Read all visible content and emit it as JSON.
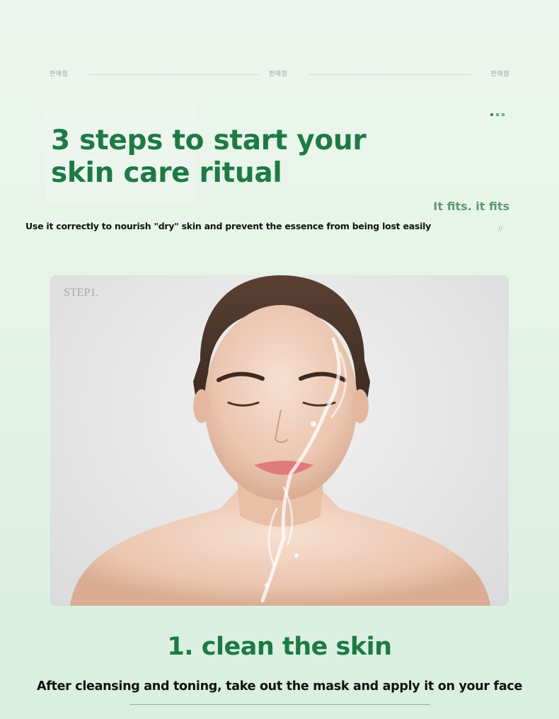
{
  "header": {
    "tags": [
      "판매점",
      "판매점",
      "판매점"
    ],
    "title_line_1": "3 steps to start your",
    "title_line_2": "skin care ritual",
    "tagline": "It fits. it fits",
    "slash_mark": "//",
    "subtitle": "Use it correctly to nourish \"dry\" skin and prevent the essence from being lost easily"
  },
  "pagination": {
    "active_index": 0,
    "count": 3
  },
  "step": {
    "label": "STEP1.",
    "image_icon": "woman-splashing-water-on-face-photo",
    "title": "1. clean the skin",
    "description": "After cleansing and toning, take out the mask and apply it on your face"
  },
  "colors": {
    "accent_green": "#1d7a45",
    "muted_green": "#5f9a74",
    "background": "#e7f4e9"
  }
}
